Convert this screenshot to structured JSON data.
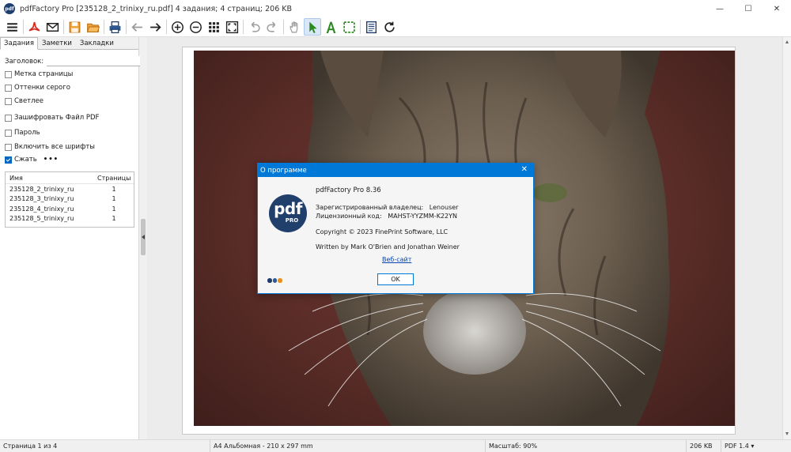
{
  "window": {
    "title": "pdfFactory Pro [235128_2_trinixy_ru.pdf] 4 задания; 4 страниц; 206 KB",
    "app_icon_text": "pdf",
    "controls": {
      "minimize": "—",
      "maximize": "☐",
      "close": "✕"
    }
  },
  "toolbar": {
    "items": [
      "menu-icon",
      "pdf-acrobat-icon",
      "email-icon",
      "save-icon",
      "open-folder-icon",
      "print-icon",
      "back-arrow-icon",
      "forward-arrow-icon",
      "zoom-in-icon",
      "zoom-out-icon",
      "thumbnails-icon",
      "fit-page-icon",
      "undo-icon",
      "redo-icon",
      "hand-icon",
      "pointer-icon",
      "text-select-icon",
      "area-select-icon",
      "document-icon",
      "refresh-icon"
    ]
  },
  "sidebar": {
    "tabs": [
      "Задания",
      "Заметки",
      "Закладки"
    ],
    "header_label": "Заголовок:",
    "header_value": "",
    "options_group1": [
      {
        "label": "Метка страницы",
        "checked": false
      },
      {
        "label": "Оттенки серого",
        "checked": false
      },
      {
        "label": "Светлее",
        "checked": false
      }
    ],
    "options_group2": [
      {
        "label": "Зашифровать Файл PDF",
        "checked": false
      },
      {
        "label": "Пароль",
        "checked": false
      },
      {
        "label": "Включить все шрифты",
        "checked": false
      },
      {
        "label": "Сжать",
        "checked": true
      }
    ],
    "more_label": "•••",
    "jobs": {
      "columns": [
        "Имя",
        "Страницы"
      ],
      "rows": [
        {
          "name": "235128_2_trinixy_ru",
          "pages": "1"
        },
        {
          "name": "235128_3_trinixy_ru",
          "pages": "1"
        },
        {
          "name": "235128_4_trinixy_ru",
          "pages": "1"
        },
        {
          "name": "235128_5_trinixy_ru",
          "pages": "1"
        }
      ]
    }
  },
  "dialog": {
    "title": "О программе",
    "logo_big": "pdf",
    "logo_small": "PRO",
    "product": "pdfFactory Pro 8.36",
    "owner_label": "Зарегистрированный владелец:",
    "owner_value": "Lenouser",
    "license_label": "Лицензионный код:",
    "license_value": "MAHST-YYZMM-K22YN",
    "copyright": "Copyright © 2023 FinePrint Software, LLC",
    "authors": "Written by Mark O'Brien and Jonathan Weiner",
    "website_link": "Веб-сайт",
    "ok_label": "OK",
    "dot_colors": [
      "#1f3c6c",
      "#2d5a96",
      "#e8901e"
    ]
  },
  "statusbar": {
    "page": "Страница 1 из 4",
    "paper": "A4 Альбомная - 210 x 297 mm",
    "zoom": "Масштаб: 90%",
    "size": "206 KB",
    "pdf_version": "PDF 1.4 ▾"
  },
  "colors": {
    "accent": "#0078d7",
    "logo_bg": "#213f6b",
    "photo_bg": "#5b2d28"
  }
}
